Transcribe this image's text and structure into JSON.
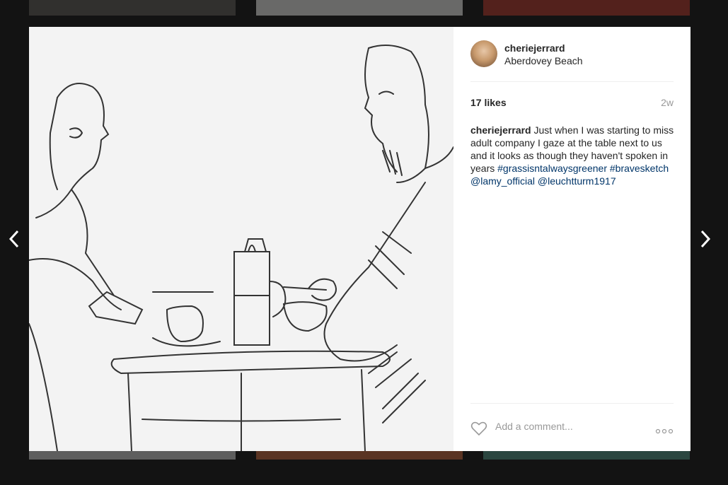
{
  "post": {
    "username": "cheriejerrard",
    "location": "Aberdovey Beach",
    "likes": "17 likes",
    "age": "2w",
    "caption": {
      "username": "cheriejerrard",
      "text": "Just when I was starting to miss adult company I gaze at the table next to us and it looks as though they haven't spoken in years",
      "tags": [
        "#grassisntalwaysgreener",
        "#bravesketch",
        "@lamy_official",
        "@leuchtturm1917"
      ]
    }
  },
  "comment": {
    "placeholder": "Add a comment..."
  },
  "icons": {
    "prev": "chevron-left-icon",
    "next": "chevron-right-icon",
    "heart": "heart-icon",
    "more": "more-options-icon"
  },
  "colors": {
    "link": "#003569",
    "text": "#262626",
    "muted": "#999999"
  }
}
